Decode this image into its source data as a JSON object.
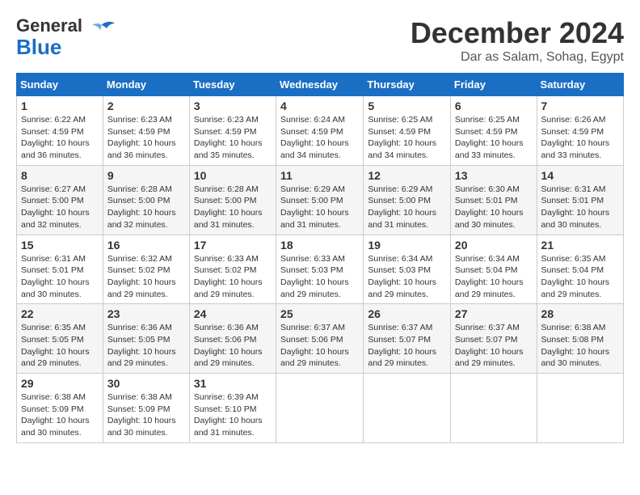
{
  "header": {
    "logo_general": "General",
    "logo_blue": "Blue",
    "month_title": "December 2024",
    "location": "Dar as Salam, Sohag, Egypt"
  },
  "days_of_week": [
    "Sunday",
    "Monday",
    "Tuesday",
    "Wednesday",
    "Thursday",
    "Friday",
    "Saturday"
  ],
  "weeks": [
    [
      {
        "day": 1,
        "sunrise": "6:22 AM",
        "sunset": "4:59 PM",
        "daylight": "10 hours and 36 minutes."
      },
      {
        "day": 2,
        "sunrise": "6:23 AM",
        "sunset": "4:59 PM",
        "daylight": "10 hours and 36 minutes."
      },
      {
        "day": 3,
        "sunrise": "6:23 AM",
        "sunset": "4:59 PM",
        "daylight": "10 hours and 35 minutes."
      },
      {
        "day": 4,
        "sunrise": "6:24 AM",
        "sunset": "4:59 PM",
        "daylight": "10 hours and 34 minutes."
      },
      {
        "day": 5,
        "sunrise": "6:25 AM",
        "sunset": "4:59 PM",
        "daylight": "10 hours and 34 minutes."
      },
      {
        "day": 6,
        "sunrise": "6:25 AM",
        "sunset": "4:59 PM",
        "daylight": "10 hours and 33 minutes."
      },
      {
        "day": 7,
        "sunrise": "6:26 AM",
        "sunset": "4:59 PM",
        "daylight": "10 hours and 33 minutes."
      }
    ],
    [
      {
        "day": 8,
        "sunrise": "6:27 AM",
        "sunset": "5:00 PM",
        "daylight": "10 hours and 32 minutes."
      },
      {
        "day": 9,
        "sunrise": "6:28 AM",
        "sunset": "5:00 PM",
        "daylight": "10 hours and 32 minutes."
      },
      {
        "day": 10,
        "sunrise": "6:28 AM",
        "sunset": "5:00 PM",
        "daylight": "10 hours and 31 minutes."
      },
      {
        "day": 11,
        "sunrise": "6:29 AM",
        "sunset": "5:00 PM",
        "daylight": "10 hours and 31 minutes."
      },
      {
        "day": 12,
        "sunrise": "6:29 AM",
        "sunset": "5:00 PM",
        "daylight": "10 hours and 31 minutes."
      },
      {
        "day": 13,
        "sunrise": "6:30 AM",
        "sunset": "5:01 PM",
        "daylight": "10 hours and 30 minutes."
      },
      {
        "day": 14,
        "sunrise": "6:31 AM",
        "sunset": "5:01 PM",
        "daylight": "10 hours and 30 minutes."
      }
    ],
    [
      {
        "day": 15,
        "sunrise": "6:31 AM",
        "sunset": "5:01 PM",
        "daylight": "10 hours and 30 minutes."
      },
      {
        "day": 16,
        "sunrise": "6:32 AM",
        "sunset": "5:02 PM",
        "daylight": "10 hours and 29 minutes."
      },
      {
        "day": 17,
        "sunrise": "6:33 AM",
        "sunset": "5:02 PM",
        "daylight": "10 hours and 29 minutes."
      },
      {
        "day": 18,
        "sunrise": "6:33 AM",
        "sunset": "5:03 PM",
        "daylight": "10 hours and 29 minutes."
      },
      {
        "day": 19,
        "sunrise": "6:34 AM",
        "sunset": "5:03 PM",
        "daylight": "10 hours and 29 minutes."
      },
      {
        "day": 20,
        "sunrise": "6:34 AM",
        "sunset": "5:04 PM",
        "daylight": "10 hours and 29 minutes."
      },
      {
        "day": 21,
        "sunrise": "6:35 AM",
        "sunset": "5:04 PM",
        "daylight": "10 hours and 29 minutes."
      }
    ],
    [
      {
        "day": 22,
        "sunrise": "6:35 AM",
        "sunset": "5:05 PM",
        "daylight": "10 hours and 29 minutes."
      },
      {
        "day": 23,
        "sunrise": "6:36 AM",
        "sunset": "5:05 PM",
        "daylight": "10 hours and 29 minutes."
      },
      {
        "day": 24,
        "sunrise": "6:36 AM",
        "sunset": "5:06 PM",
        "daylight": "10 hours and 29 minutes."
      },
      {
        "day": 25,
        "sunrise": "6:37 AM",
        "sunset": "5:06 PM",
        "daylight": "10 hours and 29 minutes."
      },
      {
        "day": 26,
        "sunrise": "6:37 AM",
        "sunset": "5:07 PM",
        "daylight": "10 hours and 29 minutes."
      },
      {
        "day": 27,
        "sunrise": "6:37 AM",
        "sunset": "5:07 PM",
        "daylight": "10 hours and 29 minutes."
      },
      {
        "day": 28,
        "sunrise": "6:38 AM",
        "sunset": "5:08 PM",
        "daylight": "10 hours and 30 minutes."
      }
    ],
    [
      {
        "day": 29,
        "sunrise": "6:38 AM",
        "sunset": "5:09 PM",
        "daylight": "10 hours and 30 minutes."
      },
      {
        "day": 30,
        "sunrise": "6:38 AM",
        "sunset": "5:09 PM",
        "daylight": "10 hours and 30 minutes."
      },
      {
        "day": 31,
        "sunrise": "6:39 AM",
        "sunset": "5:10 PM",
        "daylight": "10 hours and 31 minutes."
      },
      null,
      null,
      null,
      null
    ]
  ],
  "labels": {
    "sunrise": "Sunrise:",
    "sunset": "Sunset:",
    "daylight": "Daylight:"
  }
}
